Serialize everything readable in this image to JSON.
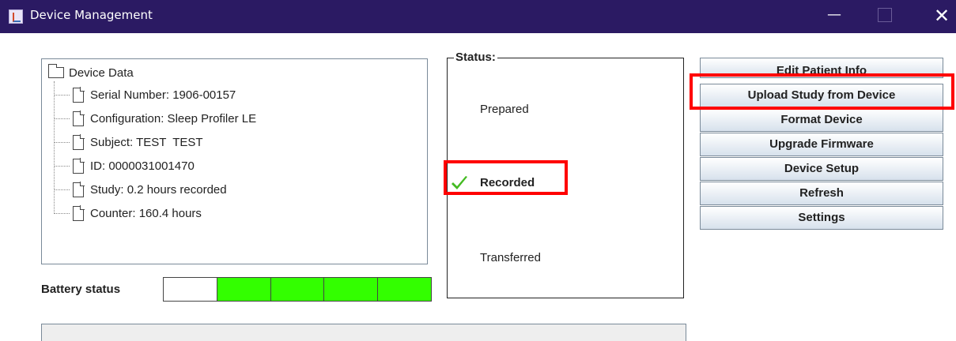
{
  "window": {
    "title": "Device Management",
    "minimize": "—",
    "close": "✕"
  },
  "device_data": {
    "root": "Device Data",
    "items": [
      "Serial Number: 1906-00157",
      "Configuration: Sleep Profiler LE",
      "Subject: TEST  TEST",
      "ID: 0000031001470",
      "Study: 0.2 hours recorded",
      "Counter: 160.4 hours"
    ]
  },
  "battery": {
    "label": "Battery status",
    "segments_total": 5,
    "segments_filled": 4,
    "fill_color": "#33ff00"
  },
  "status": {
    "legend": "Status:",
    "stages": [
      "Prepared",
      "Recorded",
      "Transferred"
    ],
    "current": "Recorded"
  },
  "actions": [
    "Edit Patient Info",
    "Upload Study from Device",
    "Format Device",
    "Upgrade Firmware",
    "Device Setup",
    "Refresh",
    "Settings"
  ],
  "colors": {
    "titlebar": "#2b1a63",
    "highlight": "#ff0000",
    "check": "#44bb22"
  }
}
